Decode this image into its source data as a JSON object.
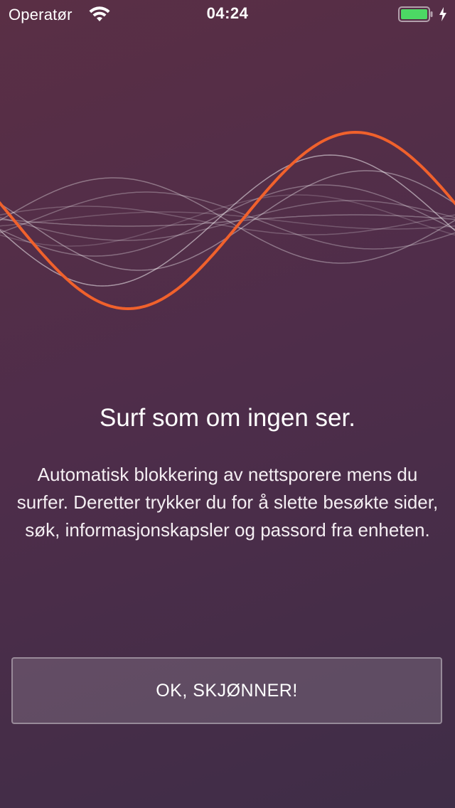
{
  "status_bar": {
    "carrier": "Operatør",
    "time": "04:24",
    "wifi_icon": "wifi-icon",
    "battery_icon": "battery-icon",
    "battery_level": 1.0,
    "battery_color": "#4cd964",
    "charging_icon": "charging-bolt-icon"
  },
  "illustration": {
    "icon": "sound-wave-illustration",
    "accent_color": "#f0612c"
  },
  "onboarding": {
    "title": "Surf som om ingen ser.",
    "description": "Automatisk blokkering av nettsporere mens du surfer. Deretter trykker du for å slette besøkte sider, søk, informasjonskapsler og passord fra enheten.",
    "button_label": "OK, SKJØNNER!"
  }
}
